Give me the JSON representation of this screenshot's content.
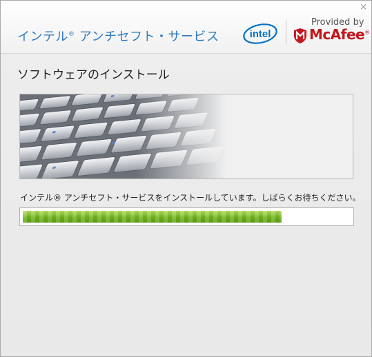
{
  "window": {
    "close_glyph": "×",
    "product_title": "インテル",
    "product_title_mark": "®",
    "product_title_rest": " アンチセフト・サービス",
    "intel_logo_text": "intel",
    "provided_by": "Provided by",
    "mcafee_logo_text": "McAfee",
    "mcafee_reg": "®"
  },
  "main": {
    "heading": "ソフトウェアのインストール",
    "status_text": "インテル® アンチセフト・サービスをインストールしています。しばらくお待ちください。",
    "progress_fraction": 0.79
  },
  "colors": {
    "title_blue": "#2f7bbf",
    "intel_blue": "#0071c5",
    "mcafee_red": "#c4161c",
    "progress_green": "#7dc21e"
  },
  "icons": {
    "banner_image": "keyboard-keys-image"
  }
}
